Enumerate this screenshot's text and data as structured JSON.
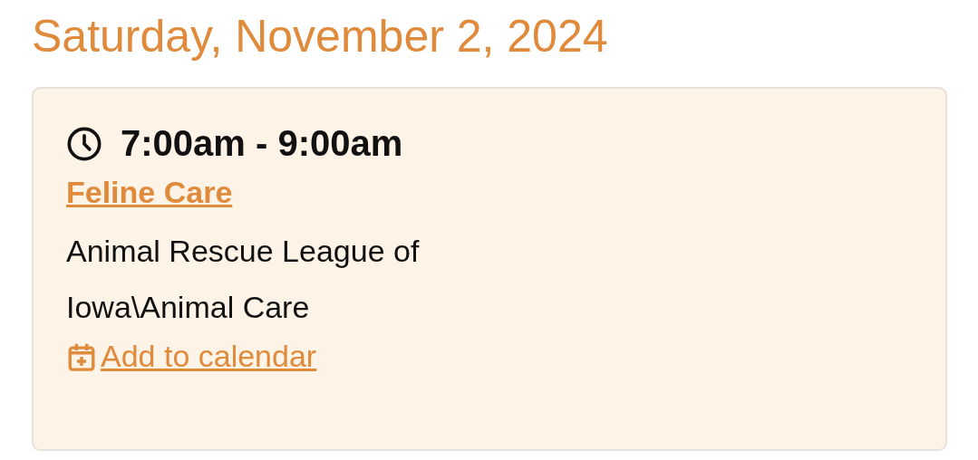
{
  "date": "Saturday, November 2, 2024",
  "event": {
    "time": "7:00am - 9:00am",
    "title": "Feline Care",
    "location": "Animal Rescue League of Iowa\\Animal Care",
    "calendar_link": "Add to calendar"
  }
}
